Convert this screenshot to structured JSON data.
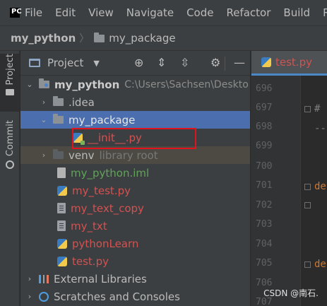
{
  "menubar": {
    "logo_text": "PC",
    "items": [
      "File",
      "Edit",
      "View",
      "Navigate",
      "Code",
      "Refactor",
      "Build",
      "R"
    ]
  },
  "breadcrumb": {
    "project": "my_python",
    "package": "my_package"
  },
  "toolstrip": {
    "project_tab": "Project",
    "commit_tab": "Commit"
  },
  "project_panel": {
    "title": "Project",
    "tree": [
      {
        "label": "my_python",
        "path": "C:\\Users\\Sachsen\\Deskto"
      },
      {
        "label": ".idea"
      },
      {
        "label": "my_package"
      },
      {
        "label": "__init__.py"
      },
      {
        "label": "venv",
        "note": "library root"
      },
      {
        "label": "my_python.iml"
      },
      {
        "label": "my_test.py"
      },
      {
        "label": "my_text_copy"
      },
      {
        "label": "my_txt"
      },
      {
        "label": "pythonLearn"
      },
      {
        "label": "test.py"
      },
      {
        "label": "External Libraries"
      },
      {
        "label": "Scratches and Consoles"
      }
    ]
  },
  "editor": {
    "tab_label": "test.py",
    "line_numbers": [
      "696",
      "697",
      "698",
      "699",
      "700",
      "701",
      "702",
      "703",
      "704",
      "705",
      "706",
      "707"
    ],
    "code_fragments": [
      "#",
      "--",
      "de",
      "de"
    ]
  },
  "watermark": "CSDN @南石."
}
